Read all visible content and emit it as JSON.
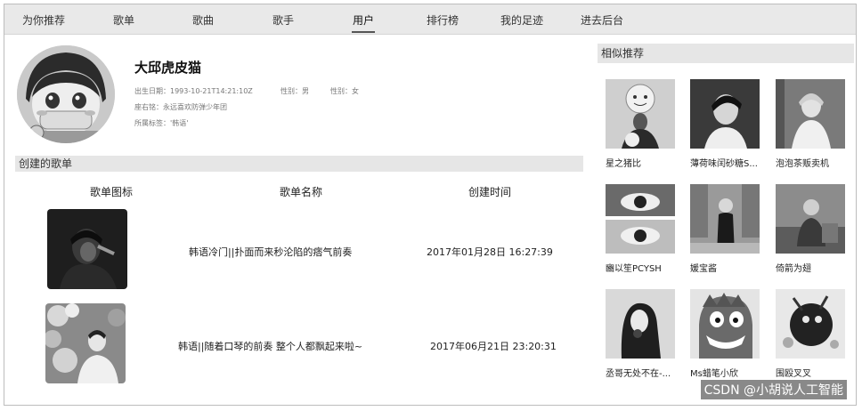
{
  "nav": {
    "items": [
      "为你推荐",
      "歌单",
      "歌曲",
      "歌手",
      "用户",
      "排行榜",
      "我的足迹",
      "进去后台"
    ],
    "active_index": 4
  },
  "profile": {
    "username": "大邱虎皮猫",
    "birthday": "出生日期：1993-10-21T14:21:10Z",
    "gender_male": "性别：男",
    "gender_female": "性别：女",
    "motto": "座右铭：永远喜欢防弹少年团",
    "tags": "所属标签：'韩语'"
  },
  "playlists": {
    "section_title": "创建的歌单",
    "columns": [
      "歌单图标",
      "歌单名称",
      "创建时间"
    ],
    "rows": [
      {
        "name": "韩语冷门||扑面而来秒沦陷的痞气前奏",
        "created": "2017年01月28日 16:27:39"
      },
      {
        "name": "韩语||随着口琴的前奏 整个人都飘起来啦~",
        "created": "2017年06月21日 23:20:31"
      }
    ]
  },
  "similar": {
    "section_title": "相似推荐",
    "users": [
      {
        "name": "星之猪比"
      },
      {
        "name": "薄荷味闰砂糖S..."
      },
      {
        "name": "泡泡茶贩卖机"
      },
      {
        "name": "豳以笙PCYSH"
      },
      {
        "name": "媛宝酱"
      },
      {
        "name": "倚箭为翅"
      },
      {
        "name": "丞哥无处不在-..."
      },
      {
        "name": "Ms蜡笔小欣"
      },
      {
        "name": "围殴叉叉"
      }
    ]
  },
  "watermark": "CSDN @小胡说人工智能"
}
